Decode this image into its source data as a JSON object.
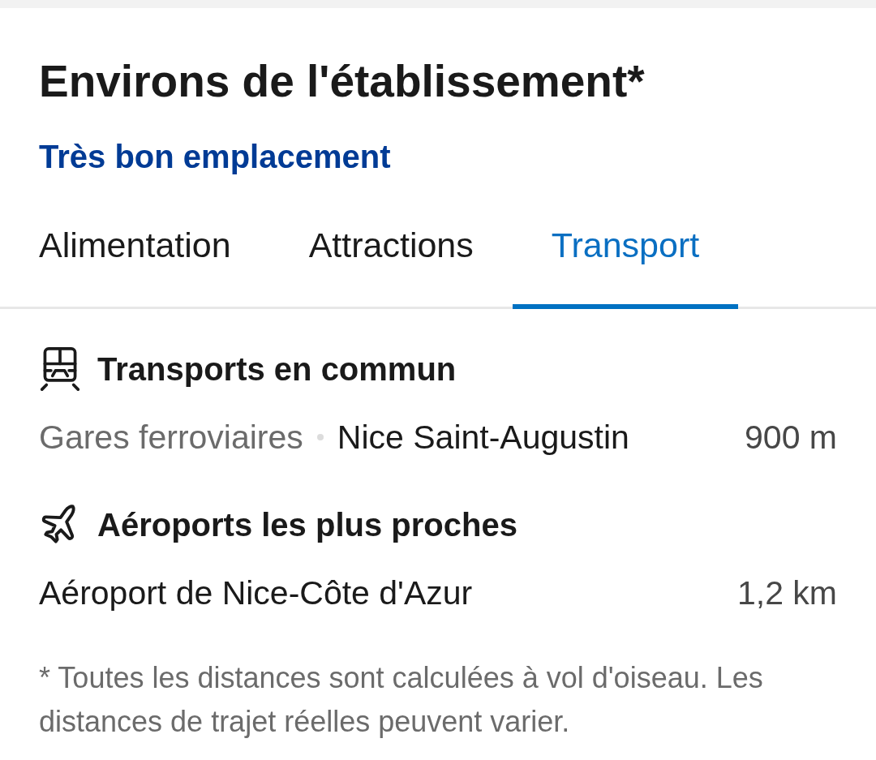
{
  "header": {
    "title": "Environs de l'établissement*",
    "rating": "Très bon emplacement"
  },
  "tabs": [
    {
      "label": "Alimentation",
      "selected": false
    },
    {
      "label": "Attractions",
      "selected": false
    },
    {
      "label": "Transport",
      "selected": true
    }
  ],
  "sections": [
    {
      "kind": "transit",
      "title": "Transports en commun",
      "items": [
        {
          "category": "Gares ferroviaires",
          "name": "Nice Saint-Augustin",
          "distance": "900 m"
        }
      ]
    },
    {
      "kind": "airport",
      "title": "Aéroports les plus proches",
      "items": [
        {
          "name": "Aéroport de Nice-Côte d'Azur",
          "distance": "1,2 km"
        }
      ]
    }
  ],
  "footnote": "* Toutes les distances sont calculées à vol d'oiseau. Les distances de trajet réelles peuvent varier."
}
